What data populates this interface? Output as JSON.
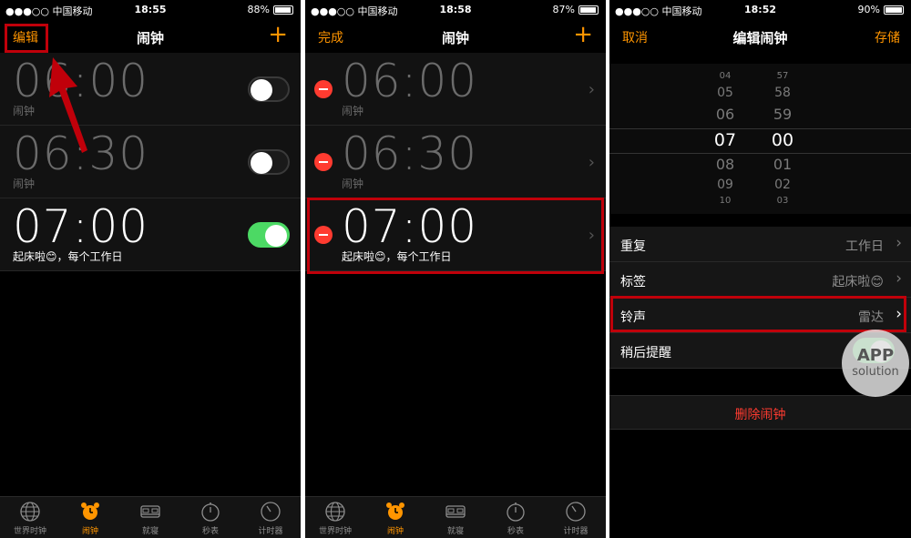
{
  "colors": {
    "accent": "#ff9500",
    "on": "#4cd964",
    "delete": "#ff3b30",
    "annotation": "#c0000a"
  },
  "screen1": {
    "status": {
      "carrier": "●●●○○ 中国移动",
      "time": "18:55",
      "battery": "88%",
      "battery_level": 0.88
    },
    "nav": {
      "left": "编辑",
      "title": "闹钟",
      "right": "+"
    },
    "alarms": [
      {
        "time": "06:00",
        "label": "闹钟",
        "enabled": false
      },
      {
        "time": "06:30",
        "label": "闹钟",
        "enabled": false
      },
      {
        "time": "07:00",
        "label": "起床啦😊，每个工作日",
        "enabled": true
      }
    ]
  },
  "screen2": {
    "status": {
      "carrier": "●●●○○ 中国移动",
      "time": "18:58",
      "battery": "87%",
      "battery_level": 0.87
    },
    "nav": {
      "left": "完成",
      "title": "闹钟",
      "right": "+"
    },
    "alarms": [
      {
        "time": "06:00",
        "label": "闹钟"
      },
      {
        "time": "06:30",
        "label": "闹钟"
      },
      {
        "time": "07:00",
        "label": "起床啦😊，每个工作日"
      }
    ]
  },
  "screen3": {
    "status": {
      "carrier": "●●●○○ 中国移动",
      "time": "18:52",
      "battery": "90%",
      "battery_level": 0.9
    },
    "nav": {
      "left": "取消",
      "title": "编辑闹钟",
      "right": "存储"
    },
    "picker": {
      "hours": [
        "04",
        "05",
        "06",
        "07",
        "08",
        "09",
        "10"
      ],
      "minutes": [
        "57",
        "58",
        "59",
        "00",
        "01",
        "02",
        "03"
      ],
      "selected_hour": "07",
      "selected_minute": "00"
    },
    "rows": [
      {
        "label": "重复",
        "value": "工作日"
      },
      {
        "label": "标签",
        "value": "起床啦😊"
      },
      {
        "label": "铃声",
        "value": "雷达"
      },
      {
        "label": "稍后提醒",
        "value": ""
      }
    ],
    "delete": "删除闹钟",
    "watermark": {
      "line1": "APP",
      "line2": "solution"
    }
  },
  "tabs": [
    {
      "label": "世界时钟",
      "icon": "globe-icon"
    },
    {
      "label": "闹钟",
      "icon": "alarm-clock-icon"
    },
    {
      "label": "就寝",
      "icon": "bed-icon"
    },
    {
      "label": "秒表",
      "icon": "stopwatch-icon"
    },
    {
      "label": "计时器",
      "icon": "timer-icon"
    }
  ]
}
